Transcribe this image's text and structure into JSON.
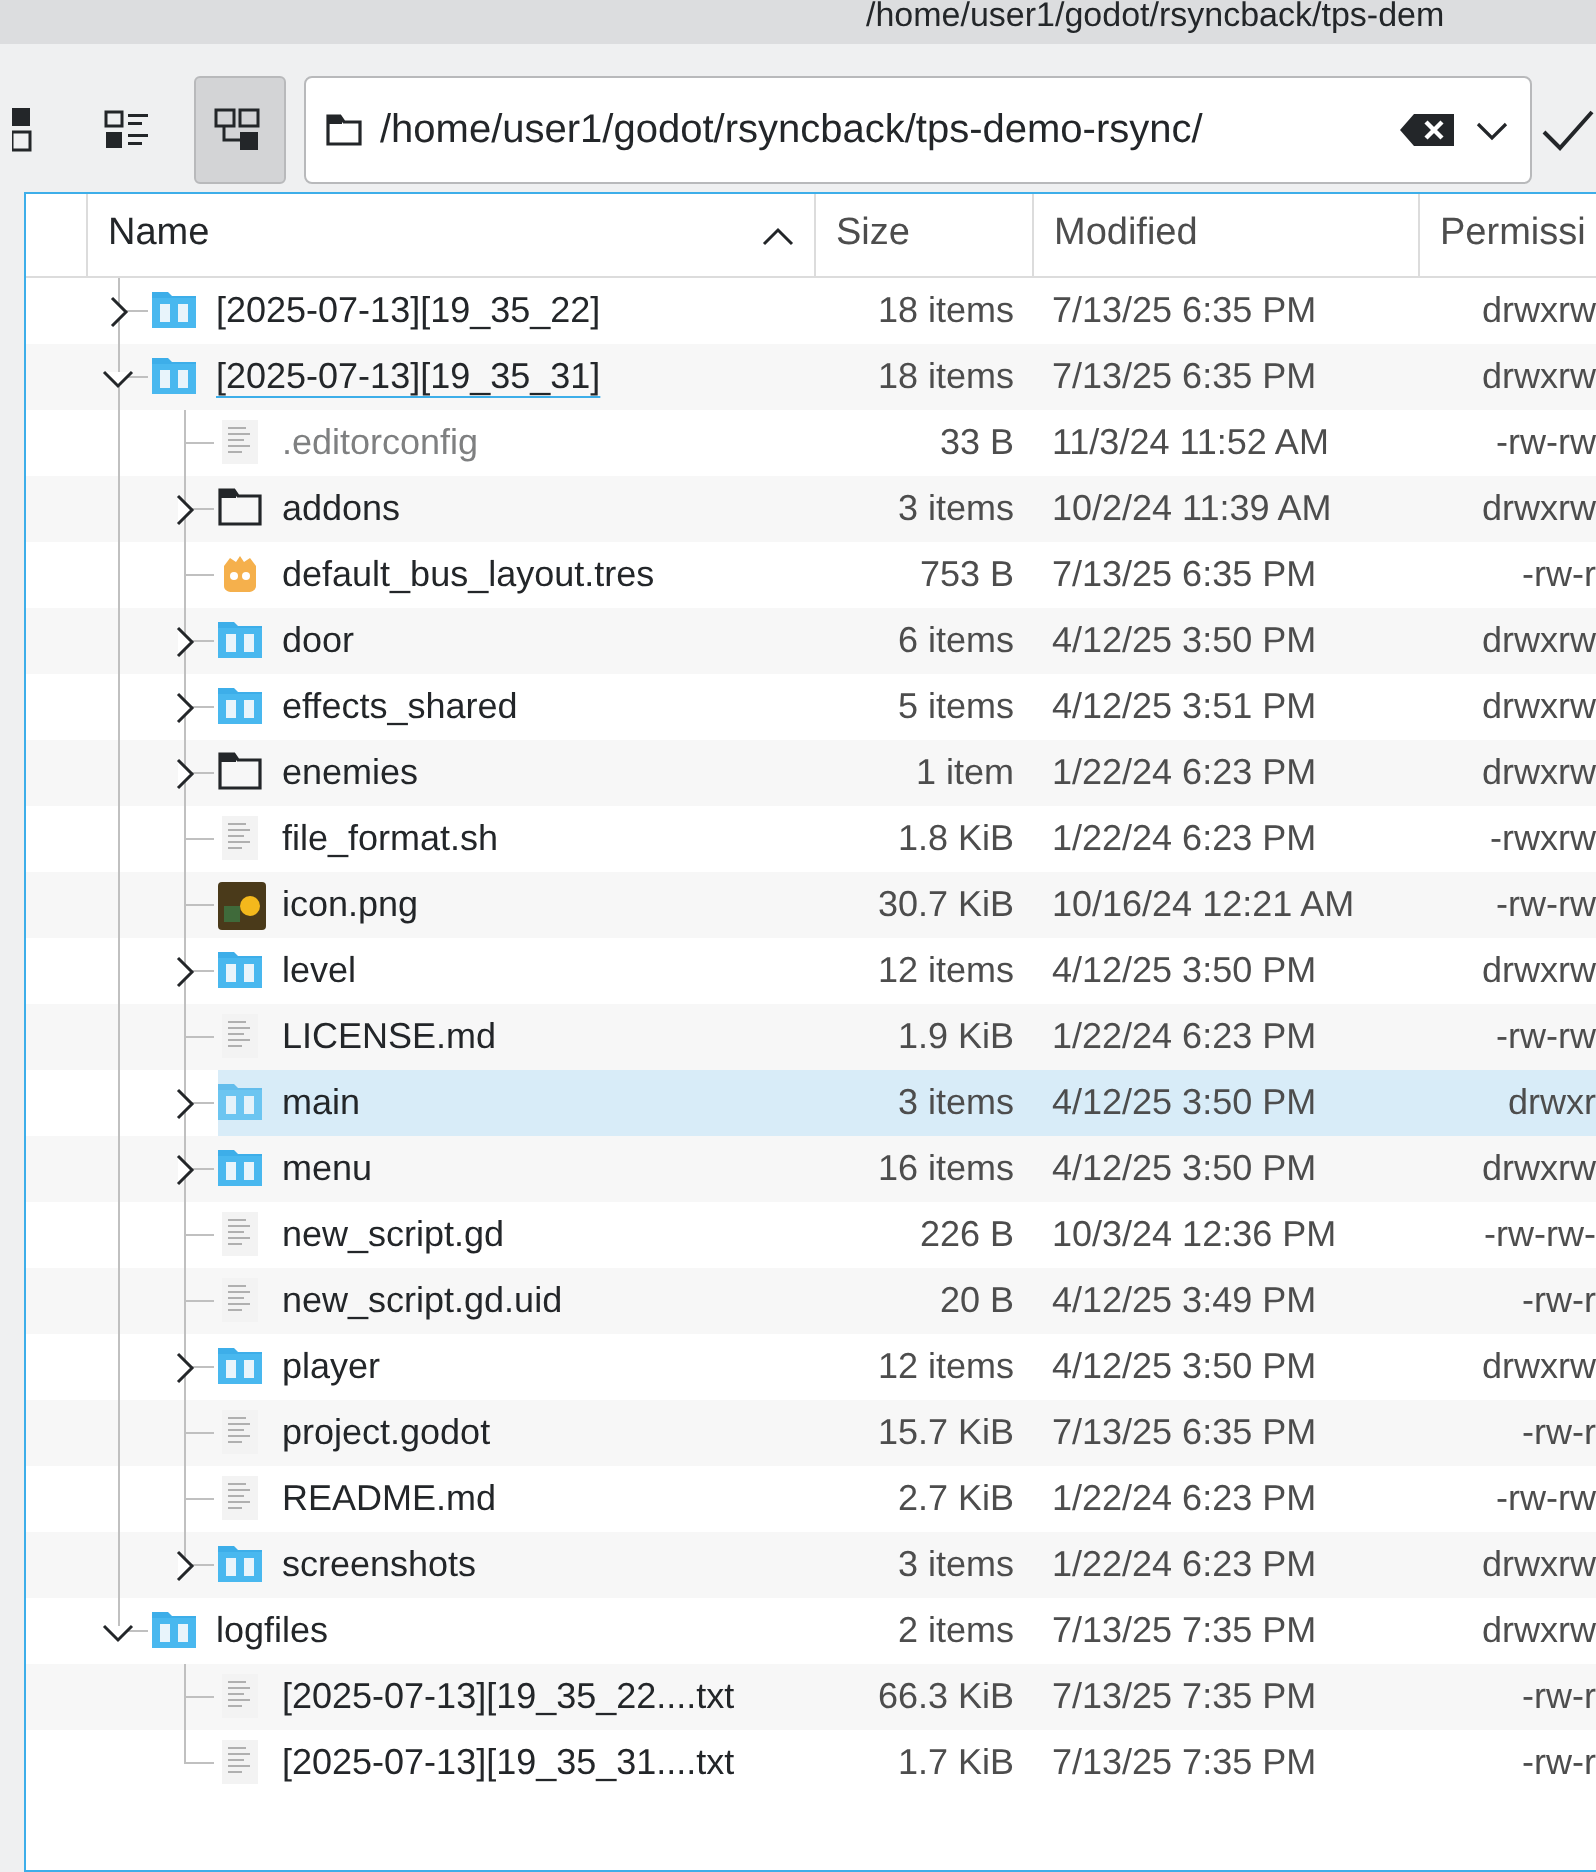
{
  "window": {
    "title": "/home/user1/godot/rsyncback/tps-dem"
  },
  "toolbar": {
    "views": [
      {
        "kind": "icons",
        "selected": false
      },
      {
        "kind": "details",
        "selected": false
      },
      {
        "kind": "tree",
        "selected": true
      }
    ],
    "path": "/home/user1/godot/rsyncback/tps-demo-rsync/"
  },
  "table": {
    "columns": [
      {
        "label": "Name",
        "sorted": true
      },
      {
        "label": "Size",
        "sorted": false
      },
      {
        "label": "Modified",
        "sorted": false
      },
      {
        "label": "Permissi",
        "sorted": false
      }
    ],
    "rows": [
      {
        "name": "[2025-07-13][19_35_22]",
        "size": "18 items",
        "modified": "7/13/25 6:35 PM",
        "permissions": "drwxrw",
        "kind": "folder",
        "expanded": false,
        "selected": false,
        "focused": false,
        "hidden": false
      },
      {
        "name": "[2025-07-13][19_35_31]",
        "size": "18 items",
        "modified": "7/13/25 6:35 PM",
        "permissions": "drwxrw",
        "kind": "folder",
        "expanded": true,
        "selected": false,
        "focused": true,
        "hidden": false,
        "children": [
          {
            "name": ".editorconfig",
            "size": "33 B",
            "modified": "11/3/24 11:52 AM",
            "permissions": "-rw-rw",
            "kind": "text-file",
            "selected": false,
            "focused": false,
            "hidden": true
          },
          {
            "name": "addons",
            "size": "3 items",
            "modified": "10/2/24 11:39 AM",
            "permissions": "drwxrw",
            "kind": "plain-folder",
            "expanded": false,
            "selected": false,
            "focused": false,
            "hidden": false
          },
          {
            "name": "default_bus_layout.tres",
            "size": "753 B",
            "modified": "7/13/25 6:35 PM",
            "permissions": "-rw-r",
            "kind": "godot-file",
            "selected": false,
            "focused": false,
            "hidden": false
          },
          {
            "name": "door",
            "size": "6 items",
            "modified": "4/12/25 3:50 PM",
            "permissions": "drwxrw",
            "kind": "folder",
            "expanded": false,
            "selected": false,
            "focused": false,
            "hidden": false
          },
          {
            "name": "effects_shared",
            "size": "5 items",
            "modified": "4/12/25 3:51 PM",
            "permissions": "drwxrw",
            "kind": "folder",
            "expanded": false,
            "selected": false,
            "focused": false,
            "hidden": false
          },
          {
            "name": "enemies",
            "size": "1 item",
            "modified": "1/22/24 6:23 PM",
            "permissions": "drwxrw",
            "kind": "plain-folder",
            "expanded": false,
            "selected": false,
            "focused": false,
            "hidden": false
          },
          {
            "name": "file_format.sh",
            "size": "1.8 KiB",
            "modified": "1/22/24 6:23 PM",
            "permissions": "-rwxrw",
            "kind": "text-file",
            "selected": false,
            "focused": false,
            "hidden": false
          },
          {
            "name": "icon.png",
            "size": "30.7 KiB",
            "modified": "10/16/24 12:21 AM",
            "permissions": "-rw-rw",
            "kind": "image-file",
            "selected": false,
            "focused": false,
            "hidden": false
          },
          {
            "name": "level",
            "size": "12 items",
            "modified": "4/12/25 3:50 PM",
            "permissions": "drwxrw",
            "kind": "folder",
            "expanded": false,
            "selected": false,
            "focused": false,
            "hidden": false
          },
          {
            "name": "LICENSE.md",
            "size": "1.9 KiB",
            "modified": "1/22/24 6:23 PM",
            "permissions": "-rw-rw",
            "kind": "text-file",
            "selected": false,
            "focused": false,
            "hidden": false
          },
          {
            "name": "main",
            "size": "3 items",
            "modified": "4/12/25 3:50 PM",
            "permissions": "drwxr",
            "kind": "folder",
            "expanded": false,
            "selected": true,
            "focused": false,
            "hidden": false
          },
          {
            "name": "menu",
            "size": "16 items",
            "modified": "4/12/25 3:50 PM",
            "permissions": "drwxrw",
            "kind": "folder",
            "expanded": false,
            "selected": false,
            "focused": false,
            "hidden": false
          },
          {
            "name": "new_script.gd",
            "size": "226 B",
            "modified": "10/3/24 12:36 PM",
            "permissions": "-rw-rw-",
            "kind": "text-file",
            "selected": false,
            "focused": false,
            "hidden": false
          },
          {
            "name": "new_script.gd.uid",
            "size": "20 B",
            "modified": "4/12/25 3:49 PM",
            "permissions": "-rw-r",
            "kind": "text-file",
            "selected": false,
            "focused": false,
            "hidden": false
          },
          {
            "name": "player",
            "size": "12 items",
            "modified": "4/12/25 3:50 PM",
            "permissions": "drwxrw",
            "kind": "folder",
            "expanded": false,
            "selected": false,
            "focused": false,
            "hidden": false
          },
          {
            "name": "project.godot",
            "size": "15.7 KiB",
            "modified": "7/13/25 6:35 PM",
            "permissions": "-rw-r",
            "kind": "text-file",
            "selected": false,
            "focused": false,
            "hidden": false
          },
          {
            "name": "README.md",
            "size": "2.7 KiB",
            "modified": "1/22/24 6:23 PM",
            "permissions": "-rw-rw",
            "kind": "text-file",
            "selected": false,
            "focused": false,
            "hidden": false
          },
          {
            "name": "screenshots",
            "size": "3 items",
            "modified": "1/22/24 6:23 PM",
            "permissions": "drwxrw",
            "kind": "folder",
            "expanded": false,
            "selected": false,
            "focused": false,
            "hidden": false
          }
        ]
      },
      {
        "name": "logfiles",
        "size": "2 items",
        "modified": "7/13/25 7:35 PM",
        "permissions": "drwxrw",
        "kind": "folder",
        "expanded": true,
        "selected": false,
        "focused": false,
        "hidden": false,
        "children": [
          {
            "name": "[2025-07-13][19_35_22....txt",
            "size": "66.3 KiB",
            "modified": "7/13/25 7:35 PM",
            "permissions": "-rw-r",
            "kind": "text-file",
            "selected": false,
            "focused": false,
            "hidden": false
          },
          {
            "name": "[2025-07-13][19_35_31....txt",
            "size": "1.7 KiB",
            "modified": "7/13/25 7:35 PM",
            "permissions": "-rw-r",
            "kind": "text-file",
            "selected": false,
            "focused": false,
            "hidden": false
          }
        ]
      }
    ]
  }
}
